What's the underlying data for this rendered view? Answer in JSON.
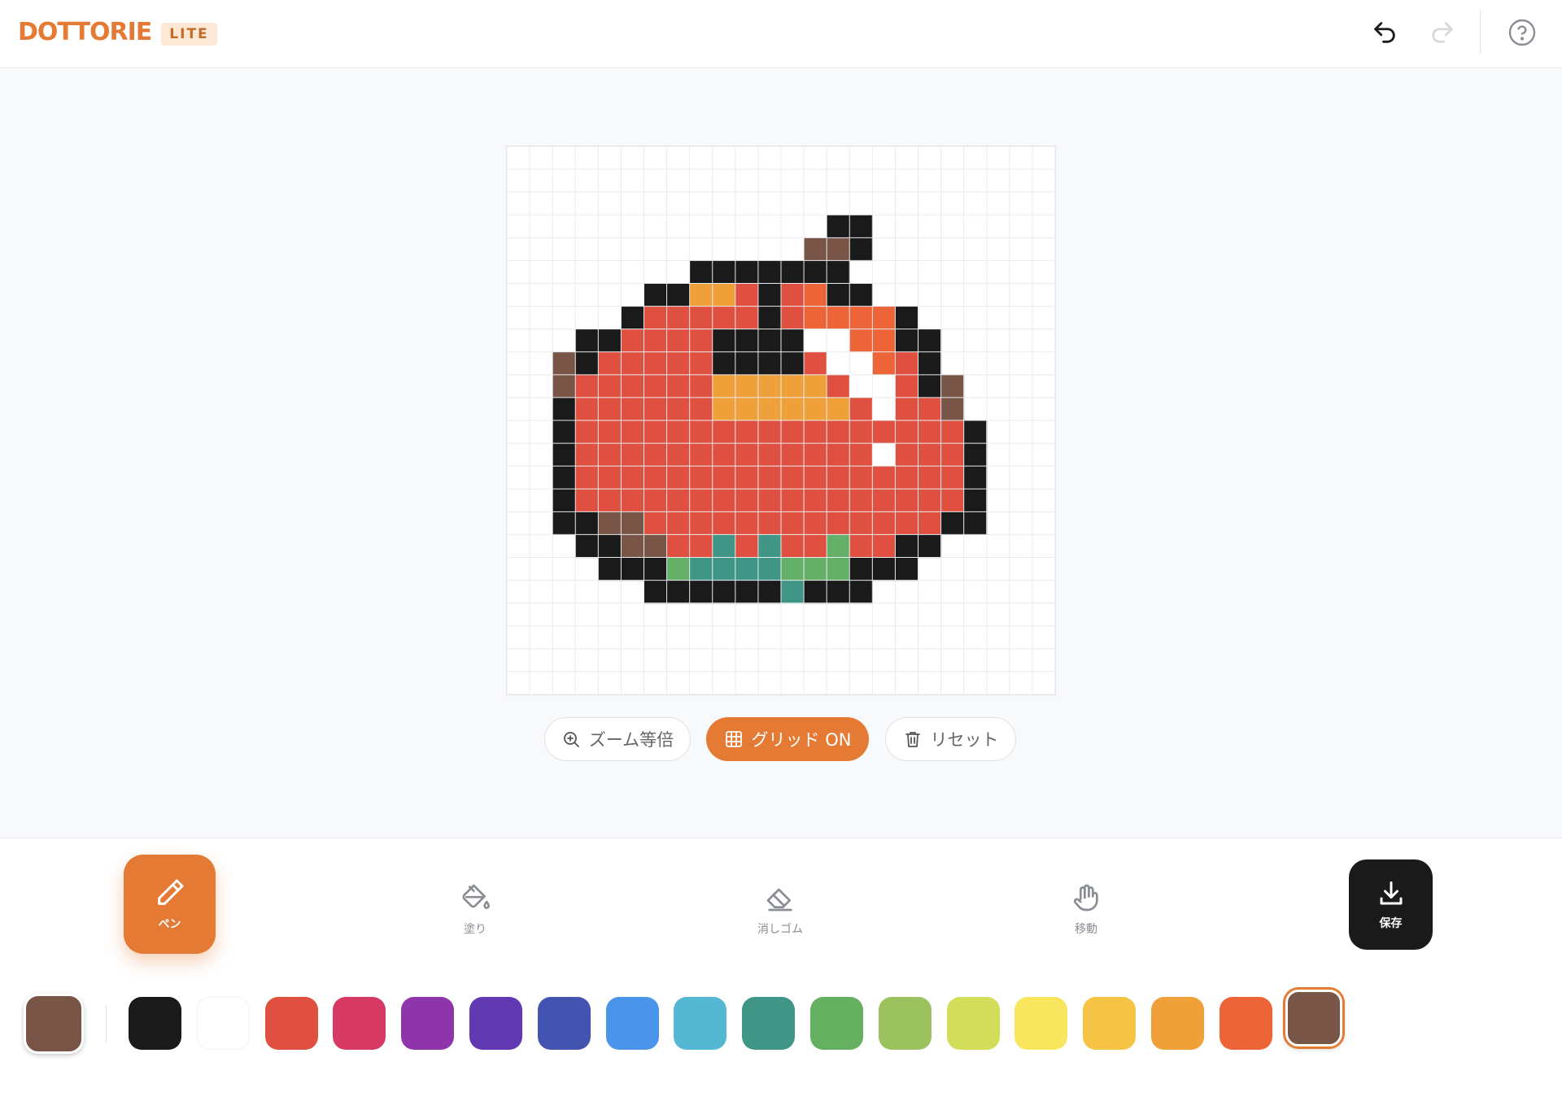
{
  "app": {
    "logo_text": "DOTTORIE",
    "logo_badge": "LITE"
  },
  "header": {
    "undo_icon": "undo-icon",
    "redo_icon": "redo-icon",
    "help_icon": "help-circle-icon"
  },
  "canvas": {
    "grid_size": 24,
    "palette_keys": {
      "K": "#1a1a1a",
      "B": "#795548",
      "R": "#e05040",
      "O": "#f0a038",
      "o": "#ed6438",
      "W": "#ffffff",
      "T": "#3f9686",
      "G": "#64b068"
    },
    "pixels": [
      "........................",
      "........................",
      "........................",
      "..............KK........",
      ".............BBK........",
      "........KKKKKKK.........",
      "......KKOORKRoKK........",
      ".....KRRRRRKRooooK......",
      "...KKRRRRKKKKWWooKK.....",
      "..BKRRRRRKKKKRWWoRK.....",
      "..BRRRRRROOOOORWWRKB....",
      "..KRRRRRROOOOOORWRRB....",
      "..KRRRRRRRRRRRRRRRRRK...",
      "..KRRRRRRRRRRRRRWRRRK...",
      "..KRRRRRRRRRRRRRRRRRK...",
      "..KRRRRRRRRRRRRRRRRRK...",
      "..KKBBRRRRRRRRRRRRRKK...",
      "...KKBBRRTRTRRGRRKK.....",
      "....KKKGTTTTGGGKKK......",
      "......KKKKKKTKKK........",
      "........................",
      "........................",
      "........................",
      "........................"
    ]
  },
  "controls": {
    "zoom_label": "ズーム等倍",
    "grid_label": "グリッド ON",
    "reset_label": "リセット"
  },
  "tools": {
    "pen": "ペン",
    "fill": "塗り",
    "eraser": "消しゴム",
    "move": "移動",
    "save": "保存"
  },
  "palette": {
    "current": "#795548",
    "swatches": [
      "#1a1a1a",
      "#ffffff",
      "#e05040",
      "#d63a64",
      "#8e35ab",
      "#6139b2",
      "#4353b0",
      "#4a94e9",
      "#55b8d3",
      "#3f9686",
      "#64b060",
      "#9bc25e",
      "#d2dd5a",
      "#f8e75e",
      "#f5c444",
      "#f0a038",
      "#ed6438",
      "#795548"
    ],
    "selected_index": 17
  }
}
